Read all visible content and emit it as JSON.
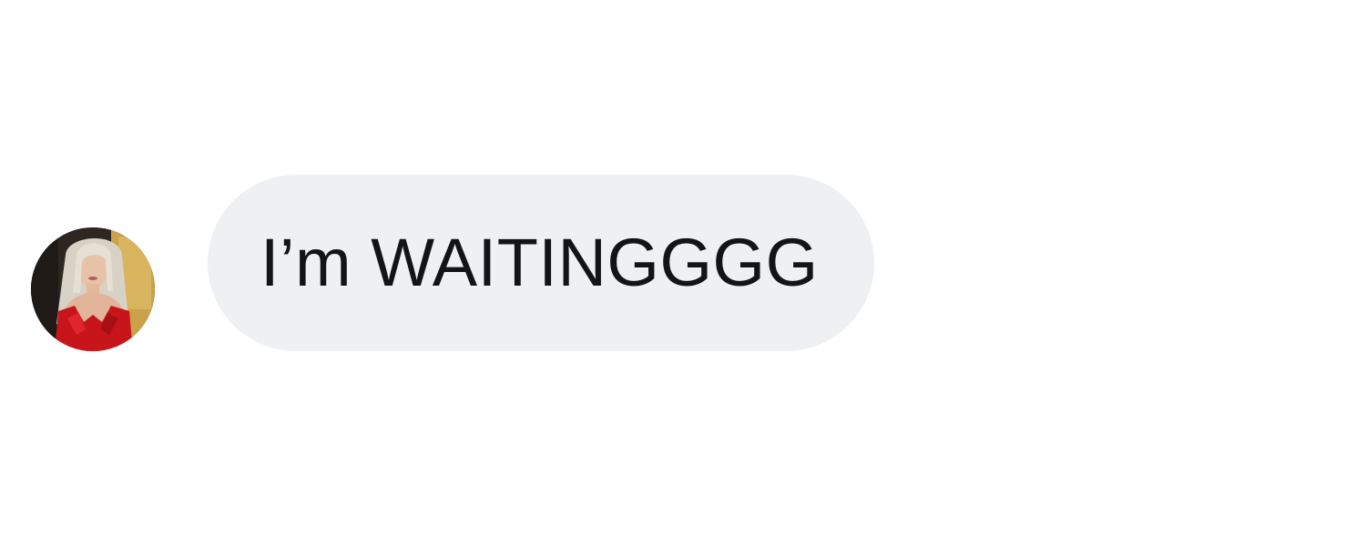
{
  "conversation": {
    "message": {
      "text": "I’m WAITINGGGG",
      "direction": "incoming",
      "sender_avatar": "profile-photo"
    }
  },
  "colors": {
    "background": "#ffffff",
    "bubble": "#eff0f2",
    "text": "#121416"
  }
}
